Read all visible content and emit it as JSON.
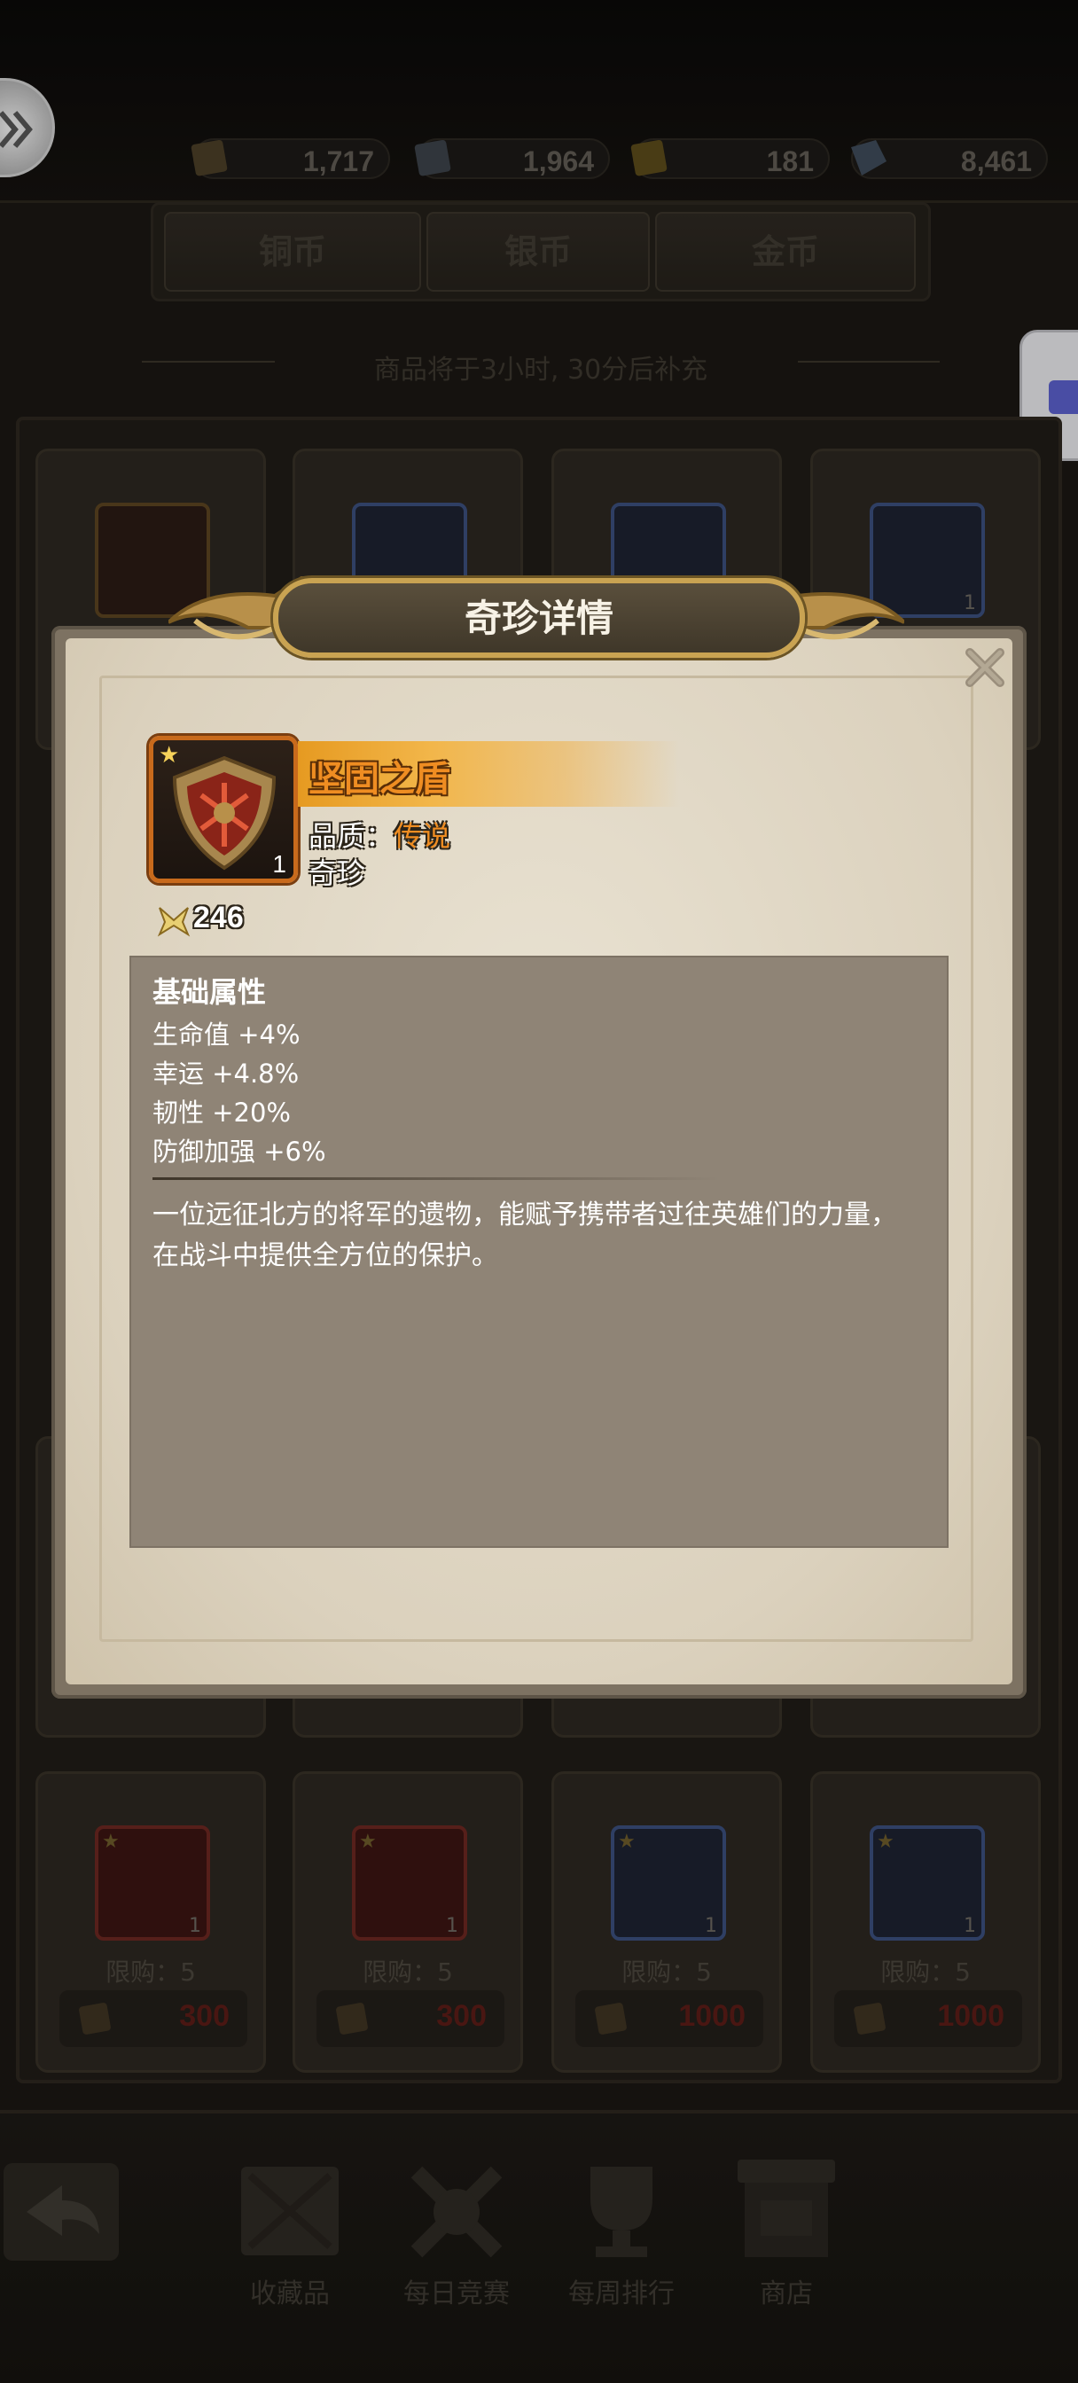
{
  "resources": [
    {
      "icon": "copper-coin-icon",
      "value": "1,717"
    },
    {
      "icon": "silver-coin-icon",
      "value": "1,964"
    },
    {
      "icon": "gold-coin-icon",
      "value": "181"
    },
    {
      "icon": "diamond-icon",
      "value": "8,461"
    }
  ],
  "tabs": [
    "铜币",
    "银币",
    "金币"
  ],
  "refresh_text": "商品将于3小时, 30分后补充",
  "shop_cards_bottom": [
    {
      "limit": "限购：5",
      "price": "300",
      "qty": "1"
    },
    {
      "limit": "限购：5",
      "price": "300",
      "qty": "1"
    },
    {
      "limit": "限购：5",
      "price": "1000",
      "qty": "1"
    },
    {
      "limit": "限购：5",
      "price": "1000",
      "qty": "1"
    }
  ],
  "shop_cards_top_qty": "1",
  "bottom_nav": [
    {
      "icon": "collection-crate-icon",
      "label": "收藏品"
    },
    {
      "icon": "crossed-swords-icon",
      "label": "每日竞赛"
    },
    {
      "icon": "trophy-icon",
      "label": "每周排行"
    },
    {
      "icon": "shop-stall-icon",
      "label": "商店"
    }
  ],
  "modal": {
    "title": "奇珍详情",
    "item": {
      "name": "坚固之盾",
      "quality_label": "品质：",
      "quality_value": "传说",
      "type": "奇珍",
      "quantity": "1",
      "power": "246"
    },
    "attributes": {
      "heading": "基础属性",
      "lines": [
        "生命值 +4%",
        "幸运 +4.8%",
        "韧性 +20%",
        "防御加强 +6%"
      ],
      "description": "一位远征北方的将军的遗物，能赋予携带者过往英雄们的力量，在战斗中提供全方位的保护。"
    }
  },
  "colors": {
    "legendary": "#ef8d22",
    "frame_gold": "#c9a352",
    "price_red": "#5a1c16"
  }
}
